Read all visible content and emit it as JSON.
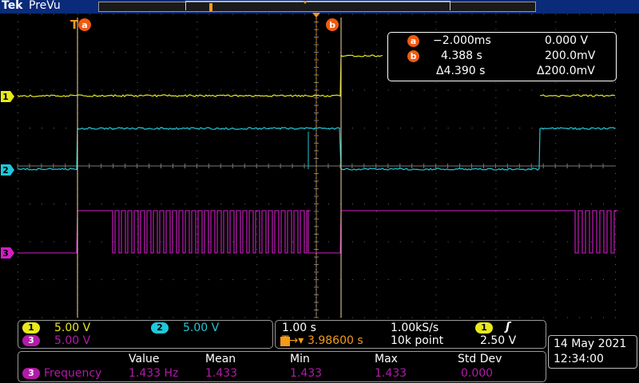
{
  "header": {
    "brand": "Tek",
    "mode": "PreVu"
  },
  "markers": {
    "trigger_pos": "T",
    "cursor_a": "a",
    "cursor_b": "b"
  },
  "channels": [
    {
      "id": "1",
      "color": "#e8e81c"
    },
    {
      "id": "2",
      "color": "#1ec8d8"
    },
    {
      "id": "3",
      "color": "#d21ec8"
    }
  ],
  "cursor_readout": {
    "a_label": "a",
    "a_time": "−2.000ms",
    "a_volt": "0.000 V",
    "b_label": "b",
    "b_time": "4.388 s",
    "b_volt": "200.0mV",
    "delta_time": "Δ4.390 s",
    "delta_volt": "Δ200.0mV"
  },
  "channel_scales": {
    "ch1_label": "1",
    "ch1_scale": "5.00 V",
    "ch2_label": "2",
    "ch2_scale": "5.00 V",
    "ch3_label": "3",
    "ch3_scale": "5.00 V"
  },
  "horizontal": {
    "time_div": "1.00 s",
    "sample_rate": "1.00kS/s",
    "trigger_source": "1",
    "trigger_slope_icon": "rising-edge-icon",
    "trigger_offset_prefix": "T→▾",
    "trigger_offset": "3.98600 s",
    "record_length": "10k point",
    "trigger_level": "2.50 V"
  },
  "measurements": {
    "headers": [
      "Value",
      "Mean",
      "Min",
      "Max",
      "Std Dev"
    ],
    "rows": [
      {
        "source": "3",
        "name": "Frequency",
        "value": "1.433 Hz",
        "mean": "1.433",
        "min": "1.433",
        "max": "1.433",
        "std_dev": "0.000"
      }
    ]
  },
  "datetime": {
    "date": "14 May 2021",
    "time": "12:34:00"
  }
}
